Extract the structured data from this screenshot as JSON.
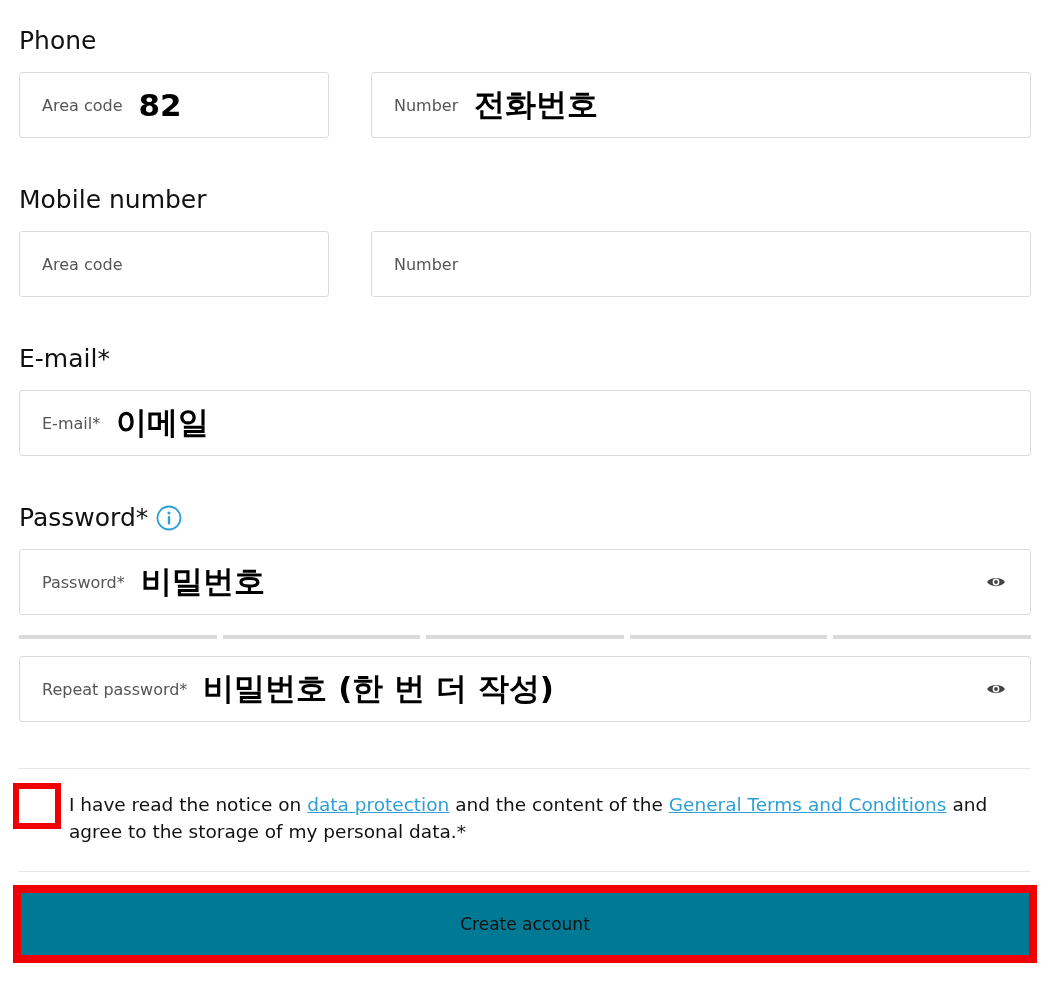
{
  "sections": [
    {
      "label": "Phone",
      "info": false,
      "fields": [
        {
          "kind": "short",
          "label": "Area code",
          "value": "82",
          "secret": false
        },
        {
          "kind": "wide",
          "label": "Number",
          "value": "전화번호",
          "secret": false
        }
      ]
    },
    {
      "label": "Mobile number",
      "info": false,
      "fields": [
        {
          "kind": "short",
          "label": "Area code",
          "secret": false
        },
        {
          "kind": "wide",
          "label": "Number",
          "secret": false
        }
      ]
    },
    {
      "label": "E-mail*",
      "info": false,
      "fields": [
        {
          "kind": "wide",
          "label": "E-mail*",
          "value": "이메일",
          "secret": false
        }
      ]
    },
    {
      "label": "Password*",
      "info": true,
      "fields": [
        {
          "kind": "wide",
          "label": "Password*",
          "value": "비밀번호",
          "secret": true
        }
      ],
      "strength": {
        "level": 0
      },
      "repeat": {
        "label": "Repeat password*",
        "value": "비밀번호 (한 번 더 작성)",
        "secret": true
      }
    }
  ],
  "consent": {
    "checked": false,
    "highlighted": true,
    "parts": [
      {
        "kind": "text",
        "text": "I have read the notice on "
      },
      {
        "kind": "link",
        "text": "data protection"
      },
      {
        "kind": "text",
        "text": " and the content of the "
      },
      {
        "kind": "link",
        "text": "General Terms and Conditions"
      },
      {
        "kind": "text",
        "text": " and agree to the storage of my personal data.*"
      }
    ]
  },
  "submit": {
    "label": "Create account",
    "highlighted": true
  }
}
